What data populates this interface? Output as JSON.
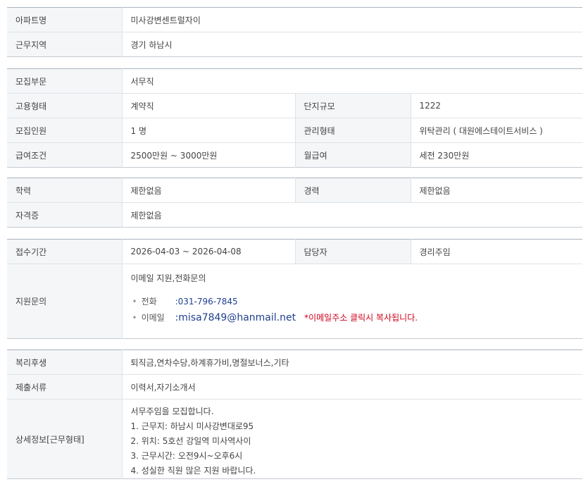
{
  "section1": {
    "apt_name": {
      "label": "아파트명",
      "value": "미사강변센트럴자이"
    },
    "work_region": {
      "label": "근무지역",
      "value": "경기 하남시"
    }
  },
  "section2": {
    "recruit_dept": {
      "label": "모집부문",
      "value": "서무직"
    },
    "employment_type": {
      "label": "고용형태",
      "value": "계약직"
    },
    "complex_size": {
      "label": "단지규모",
      "value": "1222"
    },
    "headcount": {
      "label": "모집인원",
      "value": "1 명"
    },
    "management_type": {
      "label": "관리형태",
      "value": "위탁관리 ( 대원에스테이트서비스 )"
    },
    "salary": {
      "label": "급여조건",
      "value": "2500만원 ~ 3000만원"
    },
    "monthly_pay": {
      "label": "월급여",
      "value": "세전 230만원"
    }
  },
  "section3": {
    "education": {
      "label": "학력",
      "value": "제한없음"
    },
    "experience": {
      "label": "경력",
      "value": "제한없음"
    },
    "certificate": {
      "label": "자격증",
      "value": "제한없음"
    }
  },
  "section4": {
    "period": {
      "label": "접수기간",
      "value": "2026-04-03 ~ 2026-04-08"
    },
    "manager": {
      "label": "담당자",
      "value": "경리주임"
    },
    "inquiry": {
      "label": "지원문의",
      "method": "이메일 지원,전화문의",
      "bullet": "•",
      "phone_label": "전화",
      "phone": ":031-796-7845",
      "email_label": "이메일",
      "email": ":misa7849@hanmail.net",
      "email_note": "*이메일주소 클릭시 복사됩니다."
    }
  },
  "section5": {
    "benefits": {
      "label": "복리후생",
      "value": "퇴직금,연차수당,하계휴가비,명절보너스,기타"
    },
    "documents": {
      "label": "제출서류",
      "value": "이력서,자기소개서"
    },
    "details": {
      "label": "상세정보[근무형태]",
      "lines": [
        "서무주임을 모집합니다.",
        "1. 근무지: 하남시 미사강변대로95",
        "2. 위치: 5호선 강일역 미사역사이",
        "3. 근무시간: 오전9시~오후6시",
        "4. 성실한 직원 많은 지원 바랍니다."
      ]
    }
  },
  "colors": {
    "accent_red": "#d0021b",
    "link_blue": "#1f3f8f"
  }
}
